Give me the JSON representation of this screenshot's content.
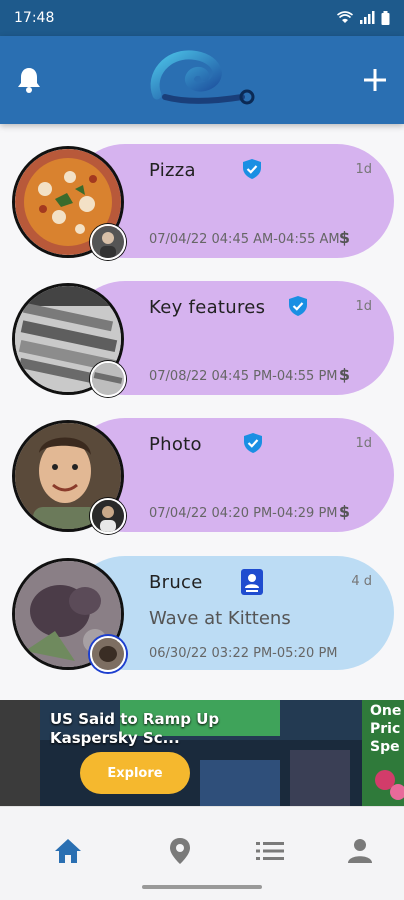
{
  "status_bar": {
    "time": "17:48",
    "icons": [
      "wifi-icon",
      "signal-icon",
      "battery-icon"
    ]
  },
  "app_bar": {
    "left_icon": "bell-icon",
    "logo": "wave-logo",
    "right_icon": "plus-icon"
  },
  "cards": [
    {
      "title": "Pizza",
      "badge": "verified-shield-icon",
      "age": "1d",
      "time": "07/04/22 04:45 AM-04:55 AM",
      "price_symbol": "$",
      "color": "#d6b3ef"
    },
    {
      "title": "Key features",
      "badge": "verified-shield-icon",
      "age": "1d",
      "time": "07/08/22 04:45 PM-04:55 PM",
      "price_symbol": "$",
      "color": "#d6b3ef"
    },
    {
      "title": "Photo",
      "badge": "verified-shield-icon",
      "age": "1d",
      "time": "07/04/22 04:20 PM-04:29 PM",
      "price_symbol": "$",
      "color": "#d6b3ef"
    },
    {
      "title": "Bruce",
      "badge": "contact-badge-icon",
      "age": "4 d",
      "subtitle": "Wave at Kittens",
      "time": "06/30/22   03:22 PM-05:20 PM",
      "color": "#bcdcf4"
    }
  ],
  "promo": {
    "headline": "US Said to Ramp Up Kaspersky Sc...",
    "side_text": "One Pric Spe",
    "button_label": "Explore"
  },
  "bottom_nav": {
    "items": [
      {
        "icon": "home-icon",
        "active": true
      },
      {
        "icon": "location-pin-icon",
        "active": false
      },
      {
        "icon": "list-icon",
        "active": false
      },
      {
        "icon": "profile-icon",
        "active": false
      }
    ]
  },
  "colors": {
    "primary": "#2a6fb2",
    "status_bar": "#1e5a8c",
    "card_purple": "#d6b3ef",
    "card_blue": "#bcdcf4",
    "verified": "#1a8fe3",
    "explore": "#f5b82e"
  }
}
